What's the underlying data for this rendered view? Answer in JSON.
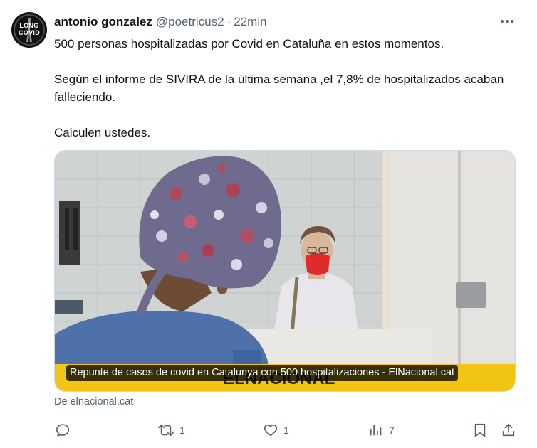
{
  "tweet": {
    "author_name": "antonio gonzalez",
    "handle": "@poetricus2",
    "separator": "·",
    "time": "22min",
    "avatar_text": "LONG\nCOVID",
    "paragraphs": [
      "500 personas hospitalizadas por Covid en Cataluña en estos momentos.",
      "Según el informe de SIVIRA de la última semana ,el 7,8% de hospitalizados acaban falleciendo.",
      "Calculen ustedes."
    ],
    "card": {
      "caption": "Repunte de casos de covid en Catalunya con 500 hospitalizaciones - ElNacional.cat",
      "watermark": "ELNACIONAL",
      "source": "De elnacional.cat"
    },
    "actions": {
      "reply": {
        "icon": "reply-icon",
        "count": ""
      },
      "retweet": {
        "icon": "retweet-icon",
        "count": "1"
      },
      "like": {
        "icon": "like-icon",
        "count": "1"
      },
      "views": {
        "icon": "views-icon",
        "count": "7"
      },
      "bookmark": {
        "icon": "bookmark-icon"
      },
      "share": {
        "icon": "share-icon"
      }
    },
    "colors": {
      "text": "#0f1419",
      "secondary": "#536471",
      "card_banner": "#f2c515",
      "mask": "#e02b2b"
    }
  }
}
